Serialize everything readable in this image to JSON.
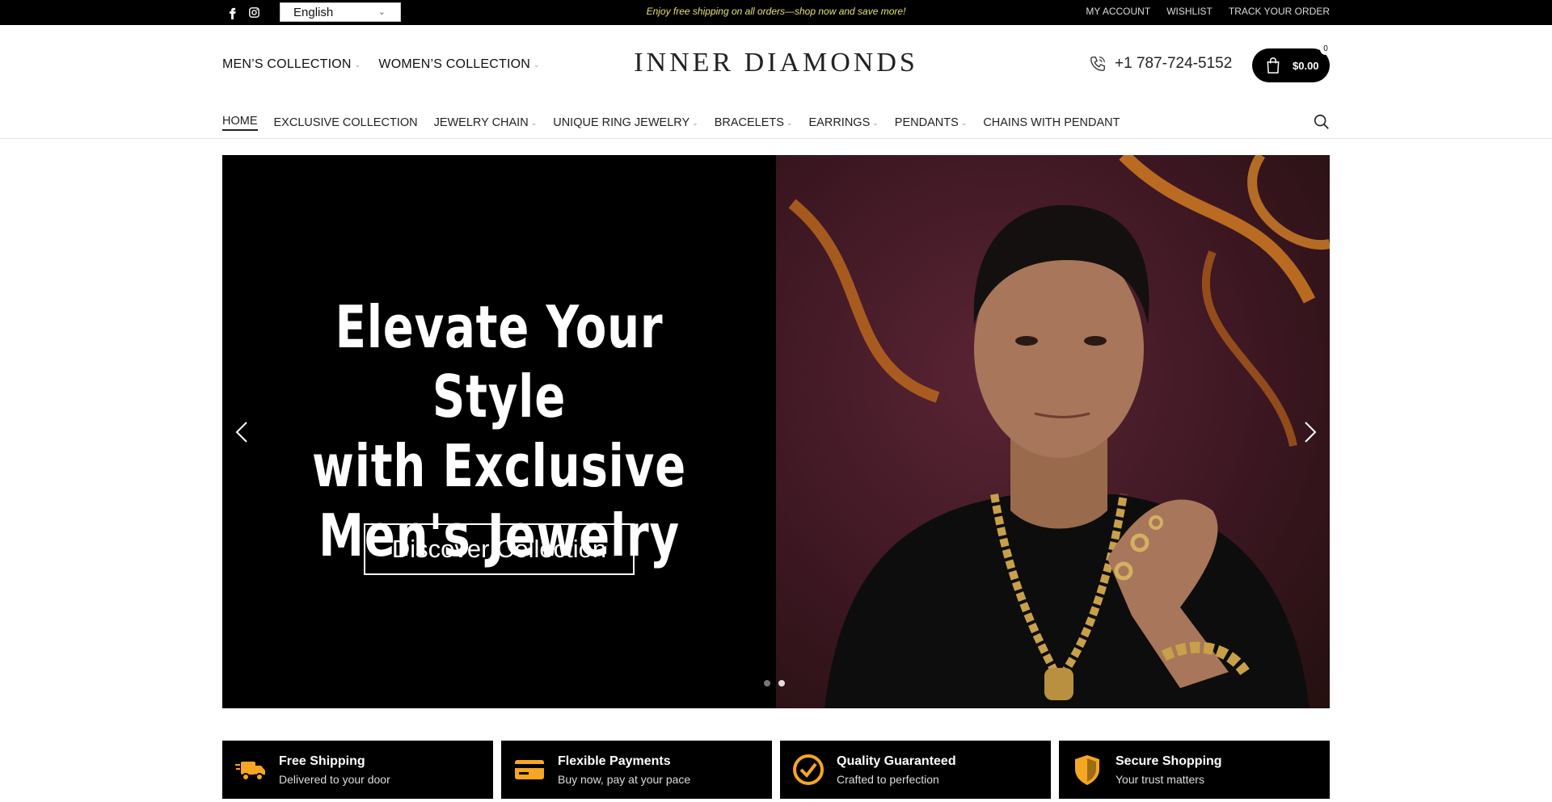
{
  "topbar": {
    "social_icons": [
      "facebook-icon",
      "instagram-icon"
    ],
    "language": "English",
    "promo": "Enjoy free shipping on all orders—shop now and save more!",
    "links": [
      "MY ACCOUNT",
      "WISHLIST",
      "TRACK YOUR ORDER"
    ]
  },
  "header": {
    "collections": [
      "MEN’S COLLECTION",
      "WOMEN’S COLLECTION"
    ],
    "logo": "INNER DIAMONDS",
    "phone": "+1 787-724-5152",
    "cart_total": "$0.00",
    "cart_count": "0"
  },
  "nav": {
    "items": [
      "HOME",
      "EXCLUSIVE COLLECTION",
      "JEWELRY CHAIN",
      "UNIQUE RING JEWELRY",
      "BRACELETS",
      "EARRINGS",
      "PENDANTS",
      "CHAINS WITH PENDANT"
    ]
  },
  "hero": {
    "title_lines": [
      "Elevate Your Style",
      "with Exclusive",
      "Men's Jewelry"
    ],
    "cta": "Discover Collection",
    "slides": 2,
    "active_slide": 2
  },
  "features": [
    {
      "title": "Free Shipping",
      "subtitle": "Delivered to your door",
      "icon": "truck-icon"
    },
    {
      "title": "Flexible Payments",
      "subtitle": "Buy now, pay at your pace",
      "icon": "credit-card-icon"
    },
    {
      "title": "Quality Guaranteed",
      "subtitle": "Crafted to perfection",
      "icon": "check-circle-icon"
    },
    {
      "title": "Secure Shopping",
      "subtitle": "Your trust matters",
      "icon": "shield-icon"
    }
  ],
  "colors": {
    "accent": "#f5a623",
    "promo_text": "#e8e07a",
    "background_dark": "#000000"
  }
}
